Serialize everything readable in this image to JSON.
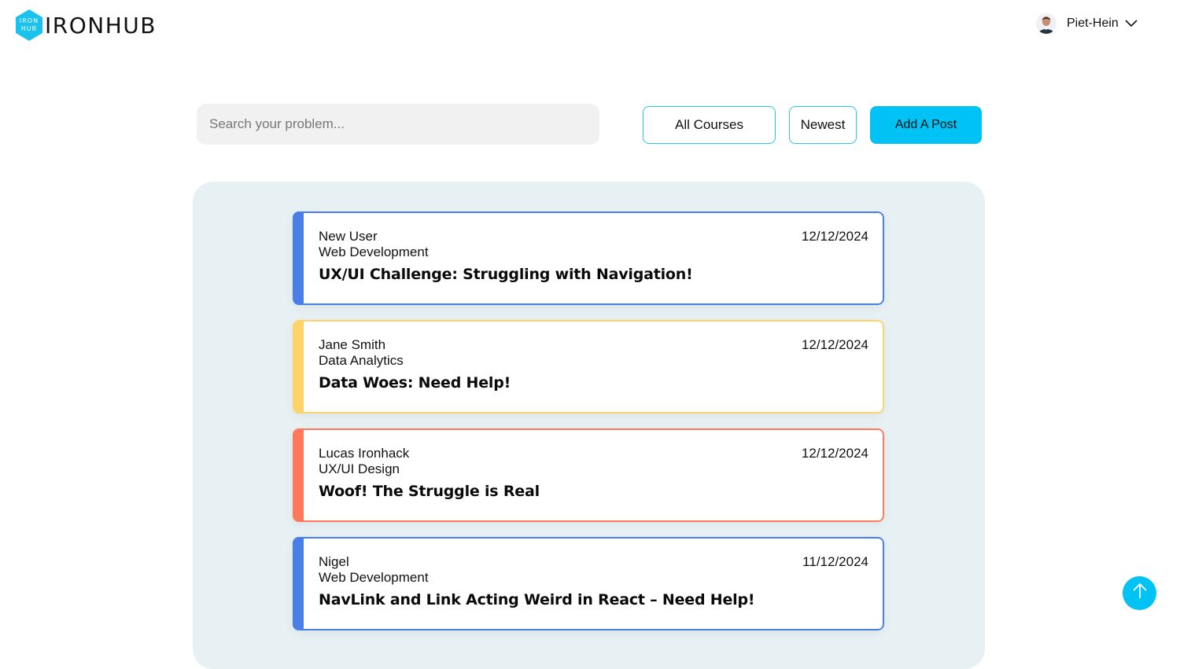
{
  "header": {
    "logo_top": "IRON",
    "logo_bottom": "HUB",
    "logo_word": "IRONHUB",
    "user_name": "Piet-Hein"
  },
  "toolbar": {
    "search_placeholder": "Search your problem...",
    "courses_label": "All Courses",
    "sort_label": "Newest",
    "add_label": "Add A Post"
  },
  "colors": {
    "accent": "#00c2f4",
    "panel": "#e7f0f3",
    "web_development": "#4a7fe6",
    "data_analytics": "#ffd36a",
    "ux_ui_design": "#ff7a5c"
  },
  "posts": [
    {
      "author": "New User",
      "course": "Web Development",
      "title": "UX/UI Challenge: Struggling with Navigation!",
      "date": "12/12/2024",
      "color": "#4a7fe6"
    },
    {
      "author": "Jane Smith",
      "course": "Data Analytics",
      "title": "Data Woes: Need Help!",
      "date": "12/12/2024",
      "color": "#ffd36a"
    },
    {
      "author": "Lucas Ironhack",
      "course": "UX/UI Design",
      "title": "Woof! The Struggle is Real",
      "date": "12/12/2024",
      "color": "#ff7a5c"
    },
    {
      "author": "Nigel",
      "course": "Web Development",
      "title": "NavLink and Link Acting Weird in React – Need Help!",
      "date": "11/12/2024",
      "color": "#4a7fe6"
    }
  ],
  "icons": {
    "logo": "hexagon-logo-icon",
    "avatar": "user-avatar",
    "dropdown": "chevron-down-icon",
    "scroll_top": "arrow-up-icon"
  }
}
